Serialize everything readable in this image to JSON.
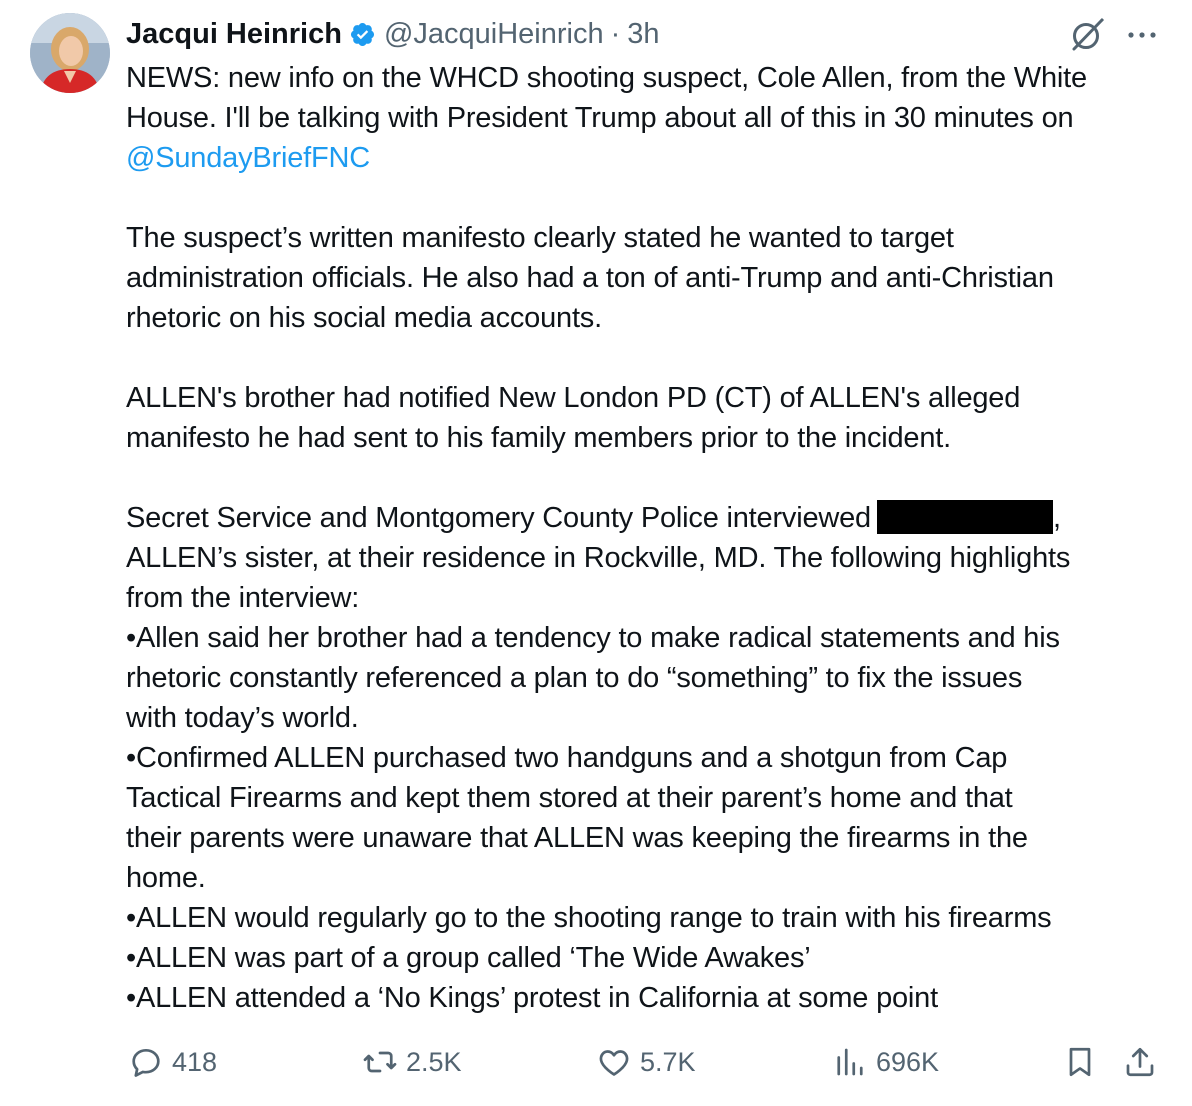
{
  "tweet": {
    "author_name": "Jacqui Heinrich",
    "author_handle": "@JacquiHeinrich",
    "separator": "·",
    "time": "3h",
    "lines": {
      "l1": "NEWS: new info on the WHCD shooting suspect, Cole Allen, from the White",
      "l2": "House. I'll be talking with President Trump about all of this in 30 minutes on",
      "l3_mention": "@SundayBriefFNC",
      "l5": "The suspect’s written manifesto clearly stated he wanted to target",
      "l6": "administration officials. He also had a ton of anti-Trump and anti-Christian",
      "l7": "rhetoric on his social media accounts.",
      "l9": "ALLEN's brother had notified New London PD (CT) of ALLEN's alleged",
      "l10": "manifesto he had sent to his family members prior to the incident.",
      "l12_a": "Secret Service and Montgomery County Police interviewed",
      "l12_b": ",",
      "l13": "ALLEN’s sister, at their residence in Rockville, MD. The following highlights",
      "l14": "from the interview:",
      "l15": "•Allen said her brother had a tendency to make radical statements and his",
      "l16": "rhetoric constantly referenced a plan to do “something” to fix the issues",
      "l17": "with today’s world.",
      "l18": "•Confirmed ALLEN purchased two handguns and a shotgun from Cap",
      "l19": "Tactical Firearms and kept them stored at their parent’s home and that",
      "l20": "their parents were unaware that ALLEN was keeping the firearms in the",
      "l21": "home.",
      "l22": "•ALLEN would regularly go to the shooting range to train with his firearms",
      "l23": "•ALLEN was part of a group called ‘The Wide Awakes’",
      "l24": "•ALLEN attended a ‘No Kings’ protest in California at some point"
    }
  },
  "actions": {
    "replies": "418",
    "reposts": "2.5K",
    "likes": "5.7K",
    "views": "696K"
  },
  "colors": {
    "text": "#0f1419",
    "muted": "#536471",
    "link": "#1d9bf0",
    "verified": "#1d9bf0"
  },
  "icons": [
    "verified-badge-icon",
    "grok-icon",
    "more-icon",
    "reply-icon",
    "repost-icon",
    "like-icon",
    "views-icon",
    "bookmark-icon",
    "share-icon"
  ]
}
